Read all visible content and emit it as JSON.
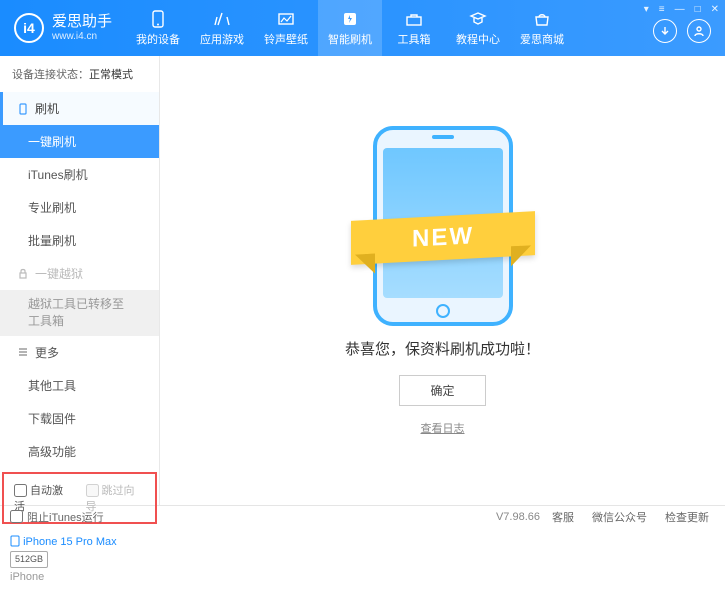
{
  "header": {
    "logo_title": "爱思助手",
    "logo_sub": "www.i4.cn",
    "nav": [
      {
        "label": "我的设备"
      },
      {
        "label": "应用游戏"
      },
      {
        "label": "铃声壁纸"
      },
      {
        "label": "智能刷机",
        "active": true
      },
      {
        "label": "工具箱"
      },
      {
        "label": "教程中心"
      },
      {
        "label": "爱思商城"
      }
    ]
  },
  "sidebar": {
    "status_label": "设备连接状态：",
    "status_value": "正常模式",
    "section_flash": "刷机",
    "items_flash": [
      {
        "label": "一键刷机",
        "active": true
      },
      {
        "label": "iTunes刷机"
      },
      {
        "label": "专业刷机"
      },
      {
        "label": "批量刷机"
      }
    ],
    "section_jailbreak": "一键越狱",
    "jailbreak_notice": "越狱工具已转移至工具箱",
    "section_more": "更多",
    "items_more": [
      {
        "label": "其他工具"
      },
      {
        "label": "下载固件"
      },
      {
        "label": "高级功能"
      }
    ],
    "auto_activate": "自动激活",
    "skip_guide": "跳过向导",
    "device_name": "iPhone 15 Pro Max",
    "device_storage": "512GB",
    "device_model": "iPhone"
  },
  "content": {
    "ribbon": "NEW",
    "success_msg": "恭喜您，保资料刷机成功啦！",
    "ok_label": "确定",
    "log_link": "查看日志"
  },
  "statusbar": {
    "block_itunes": "阻止iTunes运行",
    "version": "V7.98.66",
    "links": [
      "客服",
      "微信公众号",
      "检查更新"
    ]
  }
}
